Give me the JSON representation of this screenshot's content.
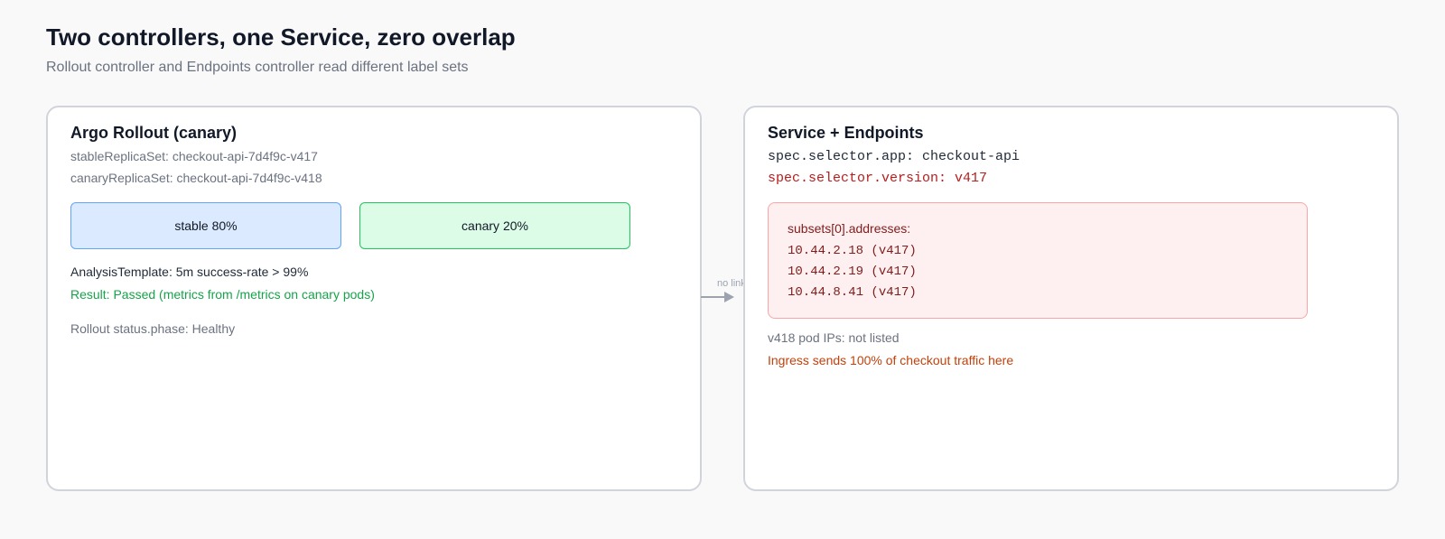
{
  "header": {
    "title": "Two controllers, one Service, zero overlap",
    "subtitle": "Rollout controller and Endpoints controller read different label sets"
  },
  "rollout": {
    "title": "Argo Rollout (canary)",
    "stable_replicaset": "stableReplicaSet: checkout-api-7d4f9c-v417",
    "canary_replicaset": "canaryReplicaSet: checkout-api-7d4f9c-v418",
    "stable_box": "stable 80%",
    "canary_box": "canary 20%",
    "analysis": "AnalysisTemplate: 5m success-rate > 99%",
    "result": "Result: Passed (metrics from /metrics on canary pods)",
    "status": "Rollout status.phase: Healthy"
  },
  "connector": {
    "label": "no link"
  },
  "service": {
    "title": "Service + Endpoints",
    "selector_app": "spec.selector.app: checkout-api",
    "selector_version": "spec.selector.version: v417",
    "addresses_header": "subsets[0].addresses:",
    "addresses": [
      "10.44.2.18 (v417)",
      "10.44.2.19 (v417)",
      "10.44.8.41 (v417)"
    ],
    "missing": "v418 pod IPs: not listed",
    "ingress": "Ingress sends 100% of checkout traffic here"
  },
  "colors": {
    "stable_fill": "#dbeafe",
    "canary_fill": "#dcfce7",
    "endpoints_fill": "#fef0f0",
    "success": "#16a34a",
    "warning": "#c2410c",
    "danger": "#b91c1c"
  }
}
